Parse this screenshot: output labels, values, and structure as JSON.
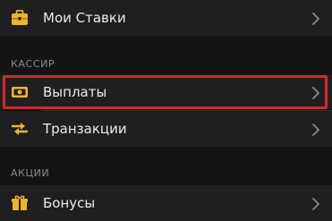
{
  "colors": {
    "background": "#141416",
    "row_background": "#1f1f21",
    "accent_icon": "#f0b429",
    "highlight_border": "#d7262b",
    "section_text": "#8a8a8f"
  },
  "menu": {
    "my_bets": {
      "label": "Мои Ставки",
      "icon": "briefcase-icon"
    },
    "cashier_header": "КАССИР",
    "payouts": {
      "label": "Выплаты",
      "icon": "banknote-icon",
      "highlighted": true
    },
    "transactions": {
      "label": "Транзакции",
      "icon": "swap-arrows-icon"
    },
    "promotions_header": "АКЦИИ",
    "bonuses": {
      "label": "Бонусы",
      "icon": "gift-icon"
    }
  }
}
